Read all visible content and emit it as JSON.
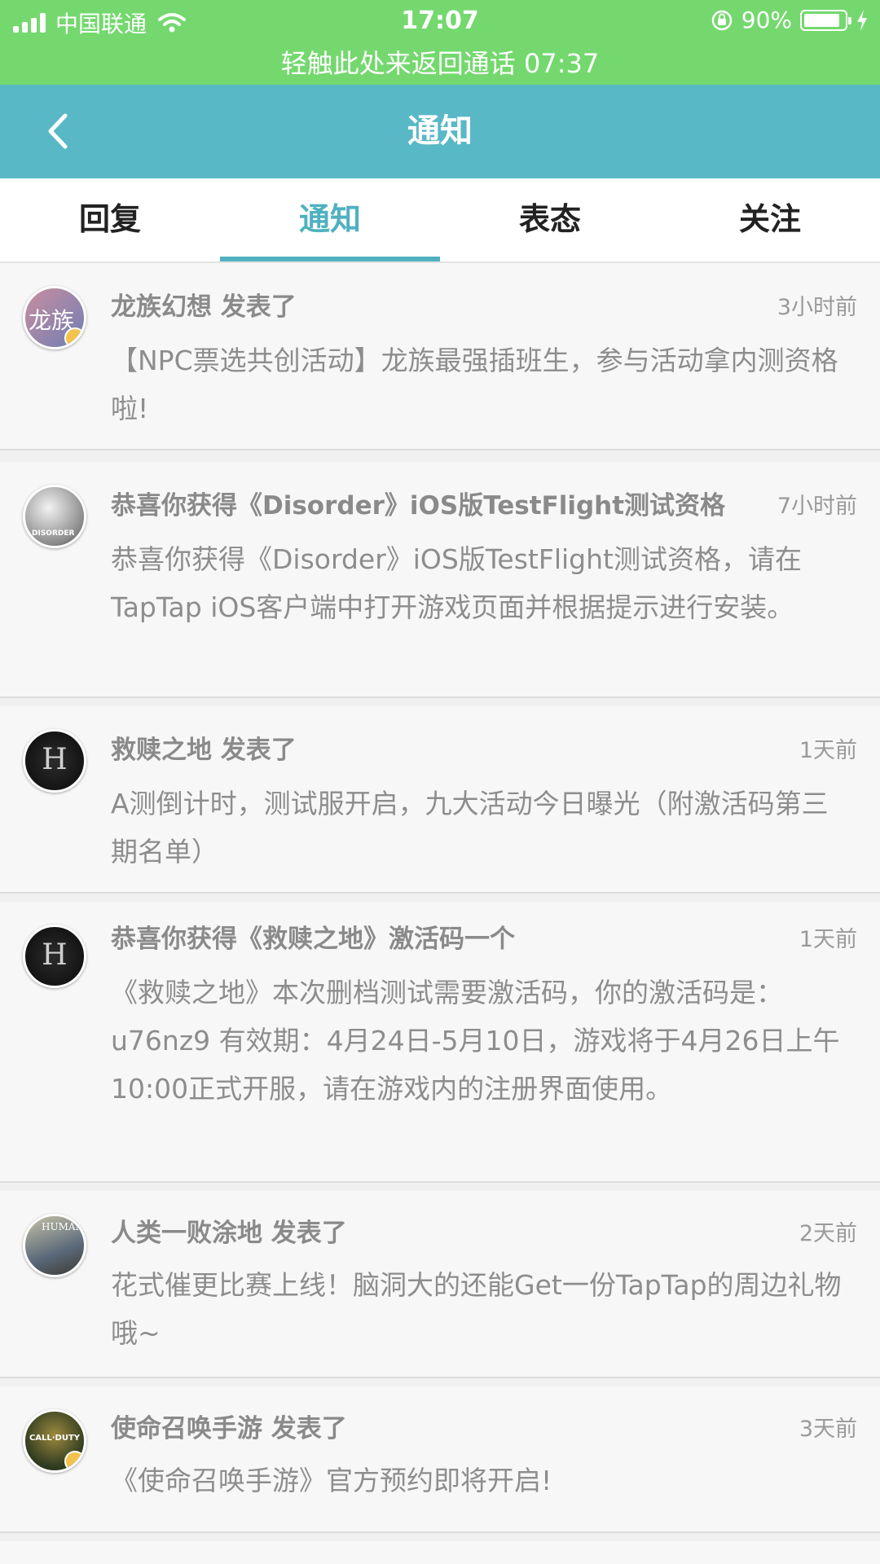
{
  "status_bar": {
    "carrier": "中国联通",
    "time": "17:07",
    "battery_percent": "90%",
    "battery_level": 0.9,
    "call_banner": "轻触此处来返回通话 07:37"
  },
  "header": {
    "title": "通知",
    "back_icon": "chevron-left-icon"
  },
  "tabs": [
    {
      "label": "回复",
      "active": false
    },
    {
      "label": "通知",
      "active": true
    },
    {
      "label": "表态",
      "active": false
    },
    {
      "label": "关注",
      "active": false
    }
  ],
  "notifications": [
    {
      "title": "龙族幻想 发表了",
      "time": "3小时前",
      "body": "【NPC票选共创活动】龙族最强插班生，参与活动拿内测资格啦!",
      "avatar_icon": "longzu-game-avatar-icon",
      "avatar_text": "龙族",
      "avatar_color": "#7b7fa8"
    },
    {
      "title": "恭喜你获得《Disorder》iOS版TestFlight测试资格",
      "time": "7小时前",
      "body": "恭喜你获得《Disorder》iOS版TestFlight测试资格，请在TapTap iOS客户端中打开游戏页面并根据提示进行安装。",
      "avatar_icon": "disorder-game-avatar-icon",
      "avatar_text": "DISORDER",
      "avatar_color": "#d8d8d8"
    },
    {
      "title": "救赎之地 发表了",
      "time": "1天前",
      "body": "A测倒计时，测试服开启，九大活动今日曝光（附激活码第三期名单）",
      "avatar_icon": "h-logo-avatar-icon",
      "avatar_text": "H",
      "avatar_color": "#141414"
    },
    {
      "title": "恭喜你获得《救赎之地》激活码一个",
      "time": "1天前",
      "body": "《救赎之地》本次删档测试需要激活码，你的激活码是：u76nz9 有效期：4月24日-5月10日，游戏将于4月26日上午10:00正式开服，请在游戏内的注册界面使用。",
      "avatar_icon": "h-logo-avatar-icon",
      "avatar_text": "H",
      "avatar_color": "#141414"
    },
    {
      "title": "人类一败涂地 发表了",
      "time": "2天前",
      "body": "花式催更比赛上线！脑洞大的还能Get一份TapTap的周边礼物哦~",
      "avatar_icon": "human-fall-flat-avatar-icon",
      "avatar_text": "HUMAN",
      "avatar_color": "#8a8670"
    },
    {
      "title": "使命召唤手游 发表了",
      "time": "3天前",
      "body": "《使命召唤手游》官方预约即将开启!",
      "avatar_icon": "call-of-duty-avatar-icon",
      "avatar_text": "CALL·DUTY",
      "avatar_color": "#4a5a2a"
    }
  ]
}
